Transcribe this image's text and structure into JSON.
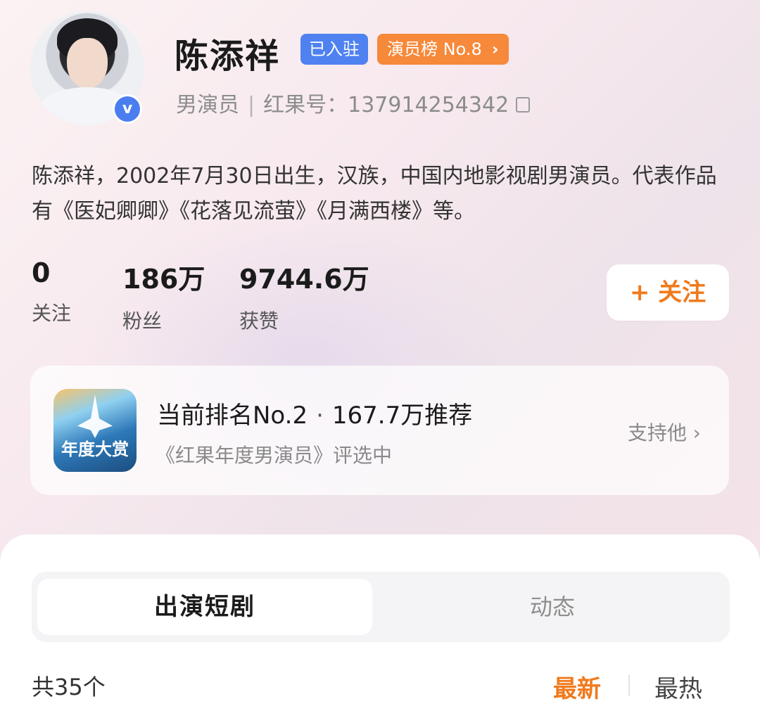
{
  "profile": {
    "name": "陈添祥",
    "badge_joined": "已入驻",
    "badge_rank": "演员榜 No.8",
    "badge_rank_chevron": "›",
    "role": "男演员",
    "separator": "|",
    "id_label": "红果号：137914254342",
    "verified_mark": "v",
    "bio": "陈添祥，2002年7月30日出生，汉族，中国内地影视剧男演员。代表作品有《医妃卿卿》《花落见流萤》《月满西楼》等。"
  },
  "stats": [
    {
      "value": "0",
      "label": "关注"
    },
    {
      "value": "186万",
      "label": "粉丝"
    },
    {
      "value": "9744.6万",
      "label": "获赞"
    }
  ],
  "follow_button": "+ 关注",
  "award": {
    "icon_text": "年度大赏",
    "rank_text": "当前排名No.2",
    "dot": "·",
    "recommend_text": "167.7万推荐",
    "subtitle": "《红果年度男演员》评选中",
    "support_label": "支持他 ›"
  },
  "tabs": [
    {
      "label": "出演短剧",
      "active": true
    },
    {
      "label": "动态",
      "active": false
    }
  ],
  "list": {
    "count_label": "共35个",
    "sort_new": "最新",
    "sort_hot": "最热"
  },
  "colors": {
    "accent_orange": "#f07a1c",
    "badge_blue": "#4f82f0",
    "badge_orange": "#f6893a",
    "verified_blue": "#4a7ef0"
  },
  "icons": {
    "copy": "copy-icon",
    "verified": "verified-icon",
    "chevron": "chevron-right-icon"
  }
}
